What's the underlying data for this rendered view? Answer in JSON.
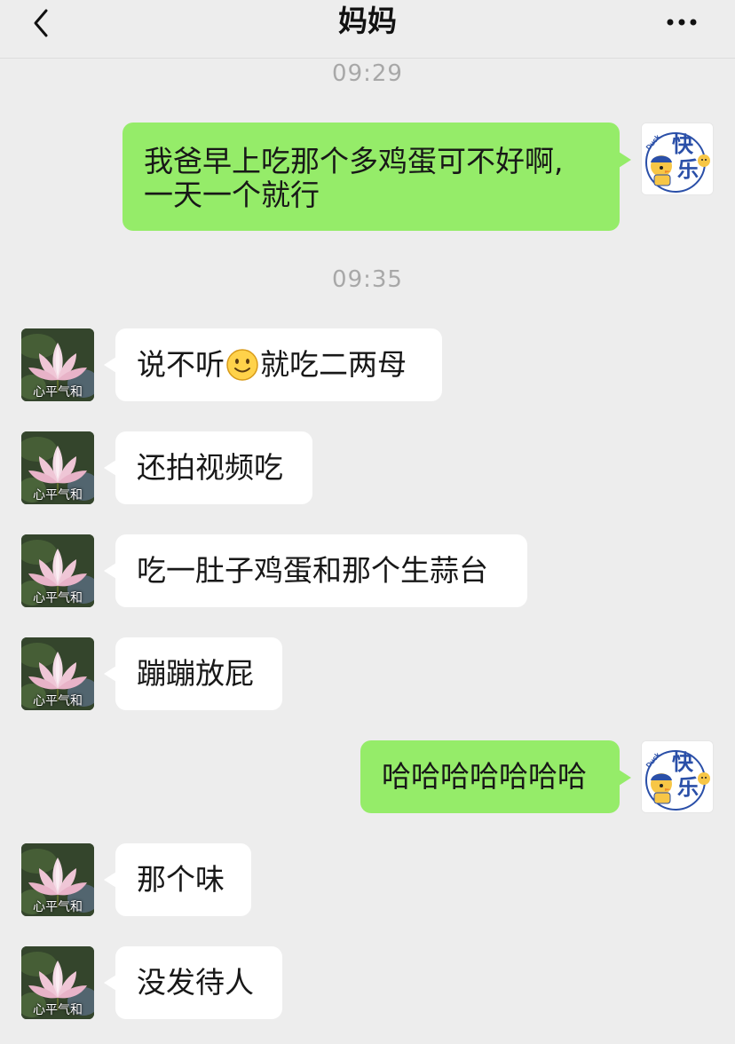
{
  "header": {
    "title": "妈妈"
  },
  "timestamps": [
    "09:29",
    "09:35"
  ],
  "avatars": {
    "mom_caption": "心平气和",
    "self_text_1": "快",
    "self_text_2": "乐"
  },
  "messages": [
    {
      "from": "self",
      "lines": [
        "我爸早上吃那个多鸡蛋可不好啊,",
        "一天一个就行"
      ]
    },
    {
      "from": "mom",
      "before_emoji": "说不听",
      "emoji": "smiling-face",
      "after_emoji": "就吃二两母"
    },
    {
      "from": "mom",
      "text": "还拍视频吃"
    },
    {
      "from": "mom",
      "text": "吃一肚子鸡蛋和那个生蒜台"
    },
    {
      "from": "mom",
      "text": "蹦蹦放屁"
    },
    {
      "from": "self",
      "text": "哈哈哈哈哈哈哈"
    },
    {
      "from": "mom",
      "text": "那个味"
    },
    {
      "from": "mom",
      "text": "没发待人"
    }
  ],
  "colors": {
    "background": "#ededed",
    "self_bubble": "#95ec69",
    "other_bubble": "#ffffff",
    "time": "#a8a8a8"
  }
}
